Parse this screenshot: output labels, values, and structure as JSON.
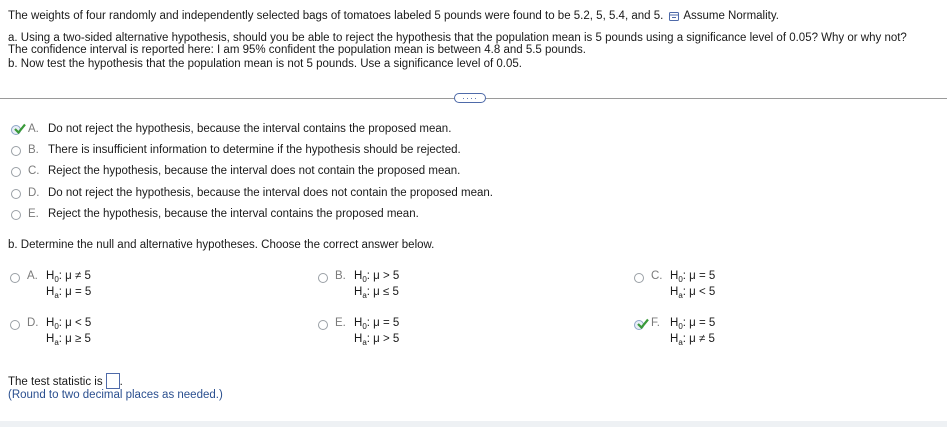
{
  "problem": {
    "intro": "The weights of four randomly and independently selected bags of tomatoes labeled 5 pounds were found to be 5.2, 5, 5.4, and 5.",
    "assume": "Assume Normality.",
    "part_a": "a. Using a two-sided alternative hypothesis, should you be able to reject the hypothesis that the population mean is 5 pounds using a significance level of 0.05? Why or why not?",
    "ci_note": "The confidence interval is reported here: I am 95% confident the population mean is between 4.8 and 5.5 pounds.",
    "part_b": "b. Now test the hypothesis that the population mean is not 5 pounds. Use a significance level of 0.05."
  },
  "more_button": "····",
  "part_a_choices": [
    {
      "letter": "A.",
      "text": "Do not reject the hypothesis, because the interval contains the proposed mean.",
      "selected": true
    },
    {
      "letter": "B.",
      "text": "There is insufficient information to determine if the hypothesis should be rejected.",
      "selected": false
    },
    {
      "letter": "C.",
      "text": "Reject the hypothesis, because the interval does not contain the proposed mean.",
      "selected": false
    },
    {
      "letter": "D.",
      "text": "Do not reject the hypothesis, because the interval does not contain the proposed mean.",
      "selected": false
    },
    {
      "letter": "E.",
      "text": "Reject the hypothesis, because the interval contains the proposed mean.",
      "selected": false
    }
  ],
  "part_b_prompt": "b. Determine the null and alternative hypotheses. Choose the correct answer below.",
  "hyp_labels": {
    "h0": "H",
    "h0_sub": "0",
    "ha": "H",
    "ha_sub": "a",
    "mu": "μ"
  },
  "part_b_choices": [
    {
      "letter": "A.",
      "h0": "≠ 5",
      "ha": "= 5",
      "selected": false
    },
    {
      "letter": "B.",
      "h0": "> 5",
      "ha": "≤ 5",
      "selected": false
    },
    {
      "letter": "C.",
      "h0": "= 5",
      "ha": "< 5",
      "selected": false
    },
    {
      "letter": "D.",
      "h0": "< 5",
      "ha": "≥ 5",
      "selected": false
    },
    {
      "letter": "E.",
      "h0": "= 5",
      "ha": "> 5",
      "selected": false
    },
    {
      "letter": "F.",
      "h0": "= 5",
      "ha": "≠ 5",
      "selected": true
    }
  ],
  "test_stat_label": "The test statistic is",
  "test_stat_suffix": ".",
  "round_hint": "(Round to two decimal places as needed.)",
  "colors": {
    "check": "#3a9a3a",
    "link": "#2a4f8f",
    "border": "#4e6aa9"
  }
}
